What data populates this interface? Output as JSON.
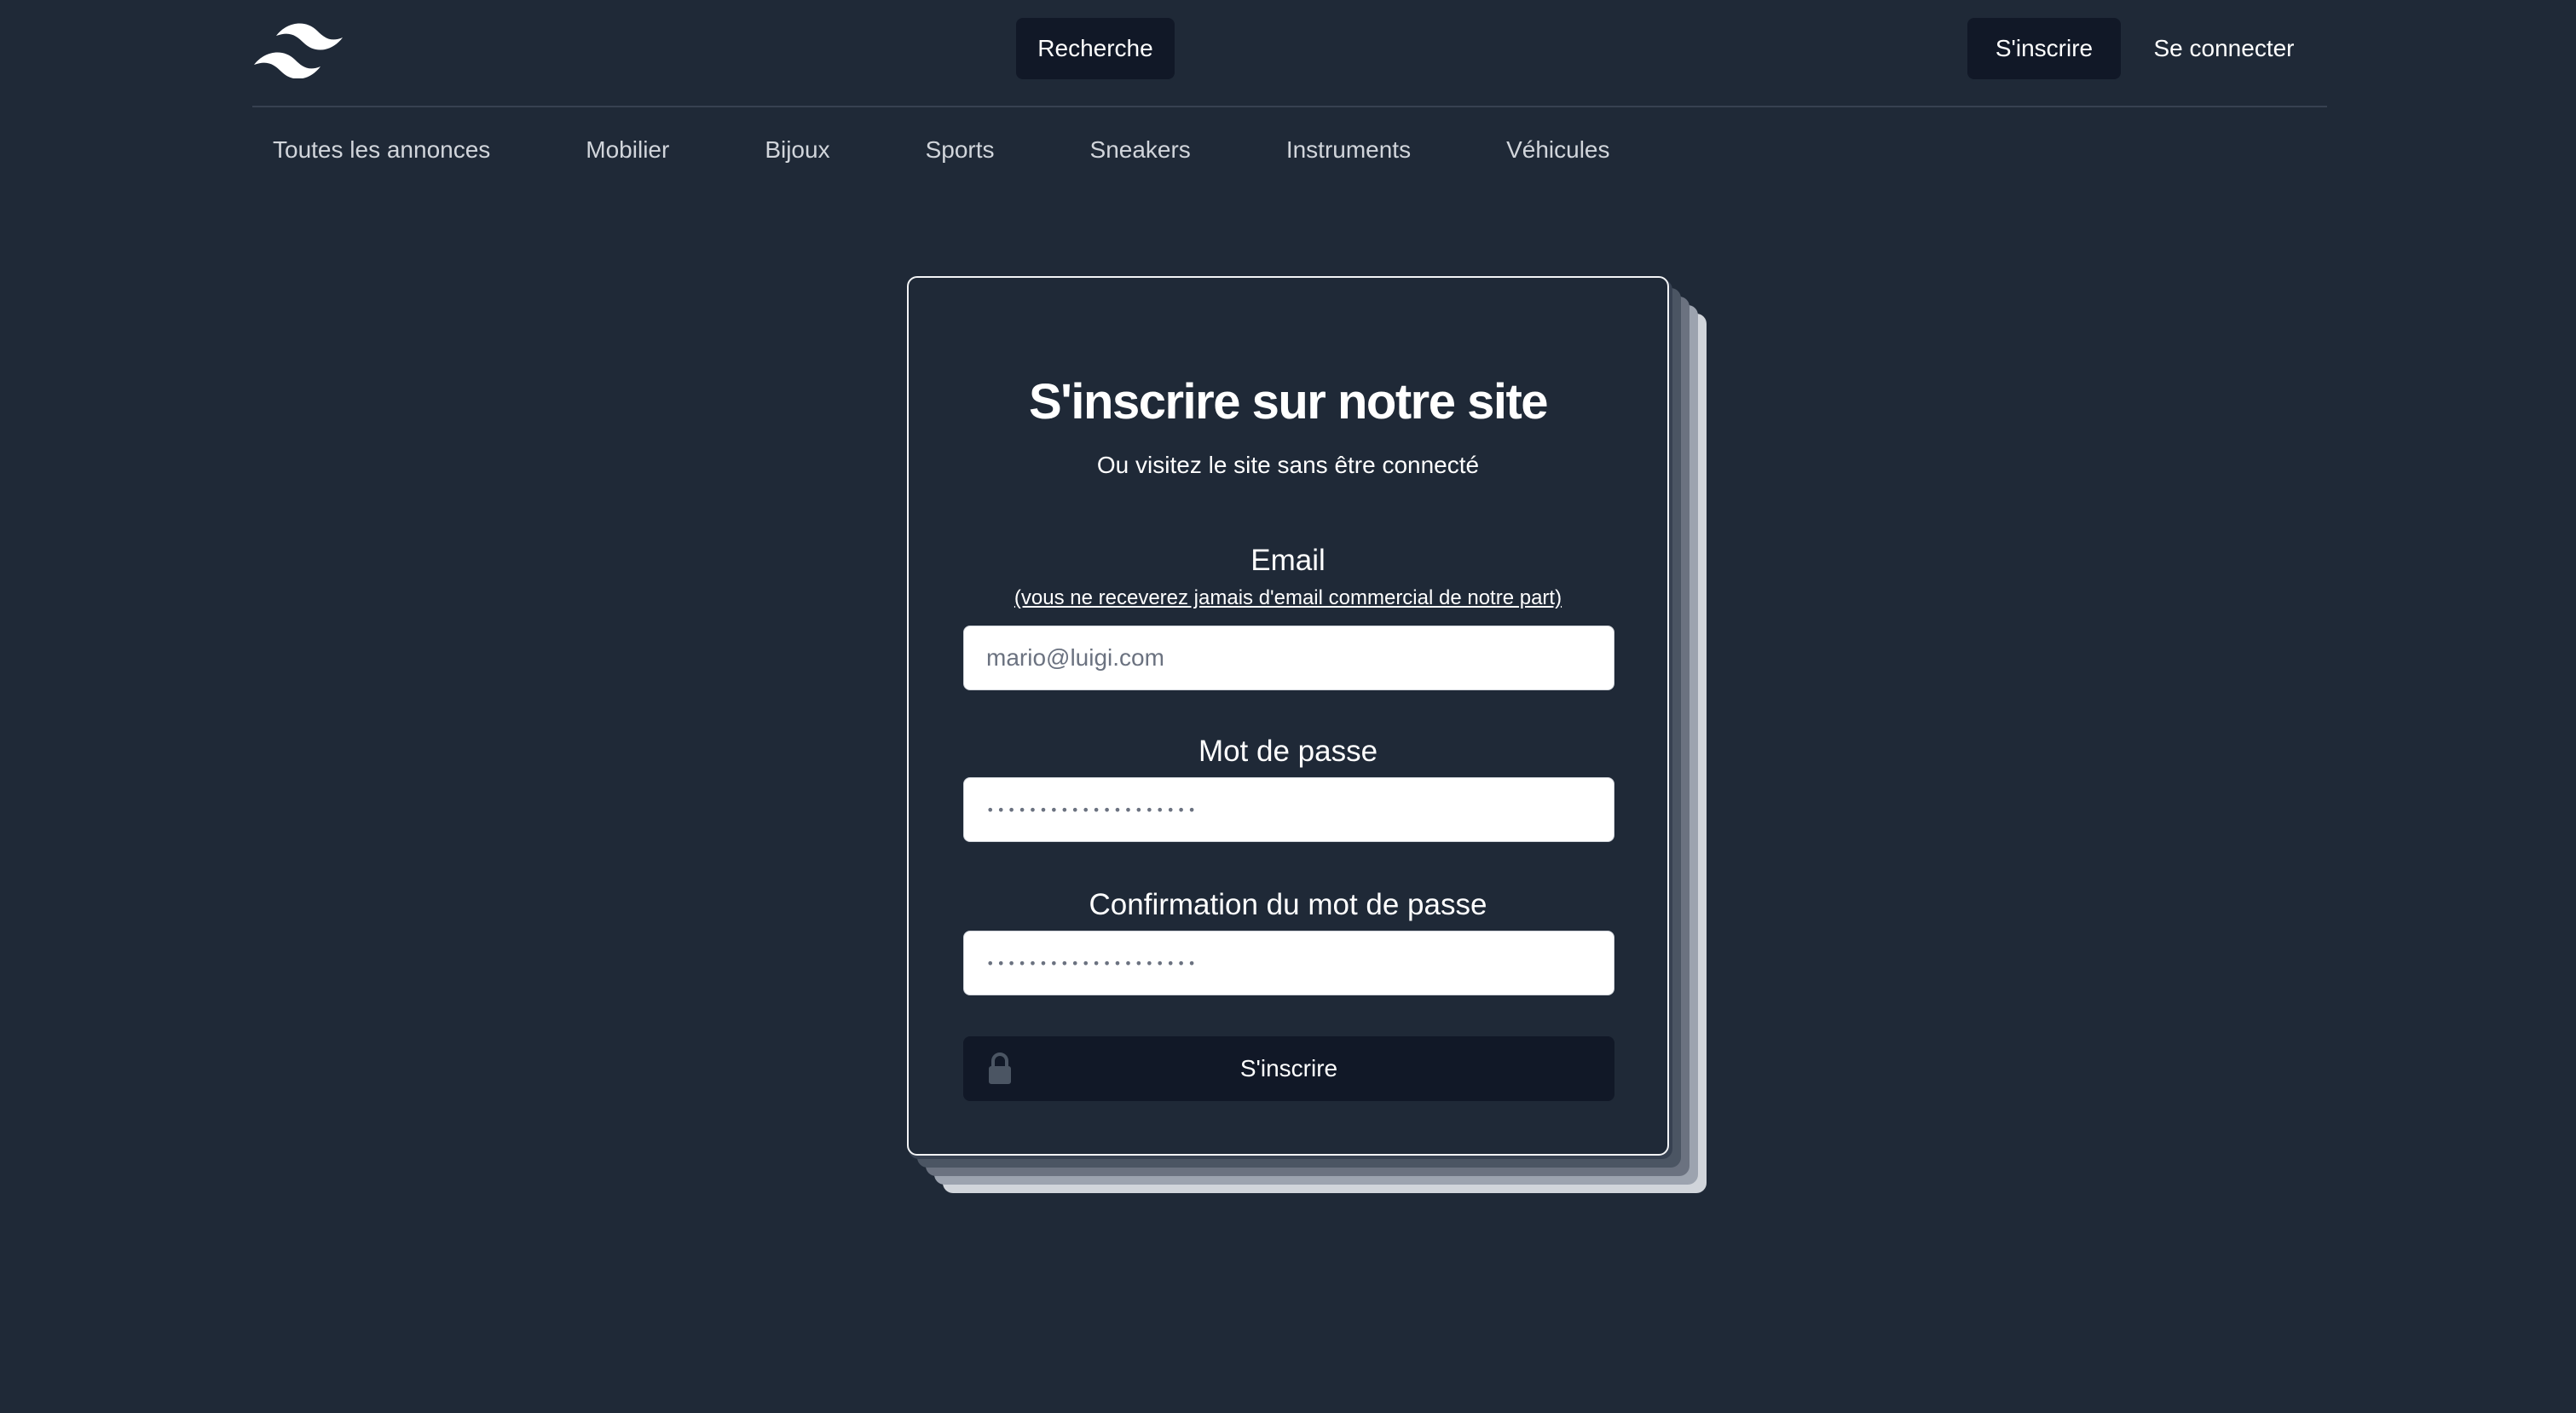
{
  "header": {
    "logo": "tailwind-wave-logo",
    "search_label": "Recherche",
    "signup_label": "S'inscrire",
    "login_label": "Se connecter"
  },
  "categories": [
    "Toutes les annonces",
    "Mobilier",
    "Bijoux",
    "Sports",
    "Sneakers",
    "Instruments",
    "Véhicules"
  ],
  "signup_form": {
    "title": "S'inscrire sur notre site",
    "subtitle": "Ou visitez le site sans être connecté",
    "email": {
      "label": "Email",
      "note": "(vous ne receverez jamais d'email commercial de notre part)",
      "placeholder": "mario@luigi.com",
      "value": ""
    },
    "password": {
      "label": "Mot de passe",
      "placeholder": "••••••••••••••••••••"
    },
    "password_confirm": {
      "label": "Confirmation du mot de passe",
      "placeholder": "••••••••••••••••••••"
    },
    "submit_label": "S'inscrire",
    "submit_icon": "lock-icon"
  },
  "colors": {
    "background": "#1f2937",
    "button_dark": "#111827",
    "text": "#ffffff",
    "nav_text": "#d1d5db",
    "divider": "#374151"
  }
}
